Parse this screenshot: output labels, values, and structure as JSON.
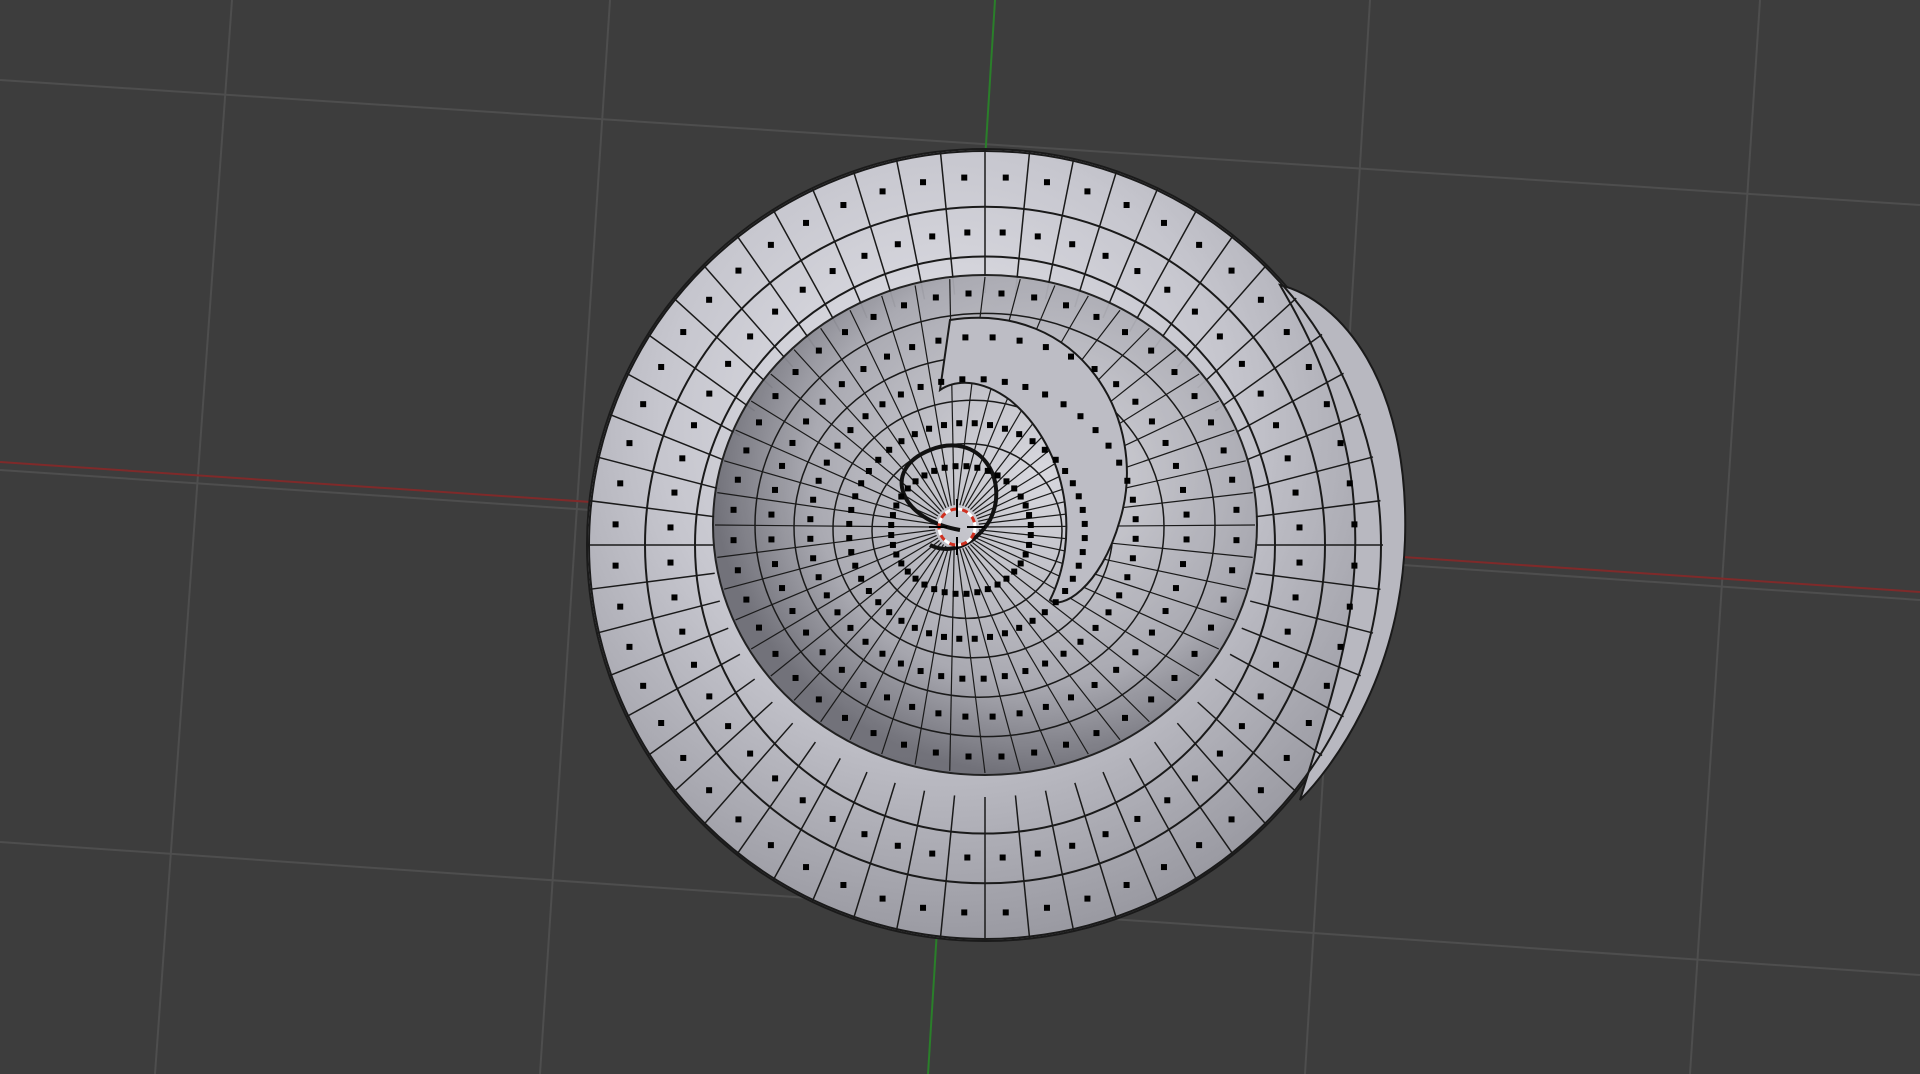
{
  "viewport": {
    "view_mode": "3d-viewport",
    "shading": "solid",
    "edit_mode": "edit-mesh",
    "object": "spiral-shell-mesh"
  },
  "colors": {
    "background": "#3d3d3d",
    "grid": "#4c4c4c",
    "x_axis": "#8a2f2f",
    "y_axis": "#2f8a2f",
    "mesh_face": "#c9c9d0",
    "mesh_edge": "#111111",
    "vertex": "#000000",
    "cursor_red": "#d03020",
    "cursor_white": "#ffffff"
  },
  "icons": {
    "cursor": "3d-cursor-icon"
  }
}
